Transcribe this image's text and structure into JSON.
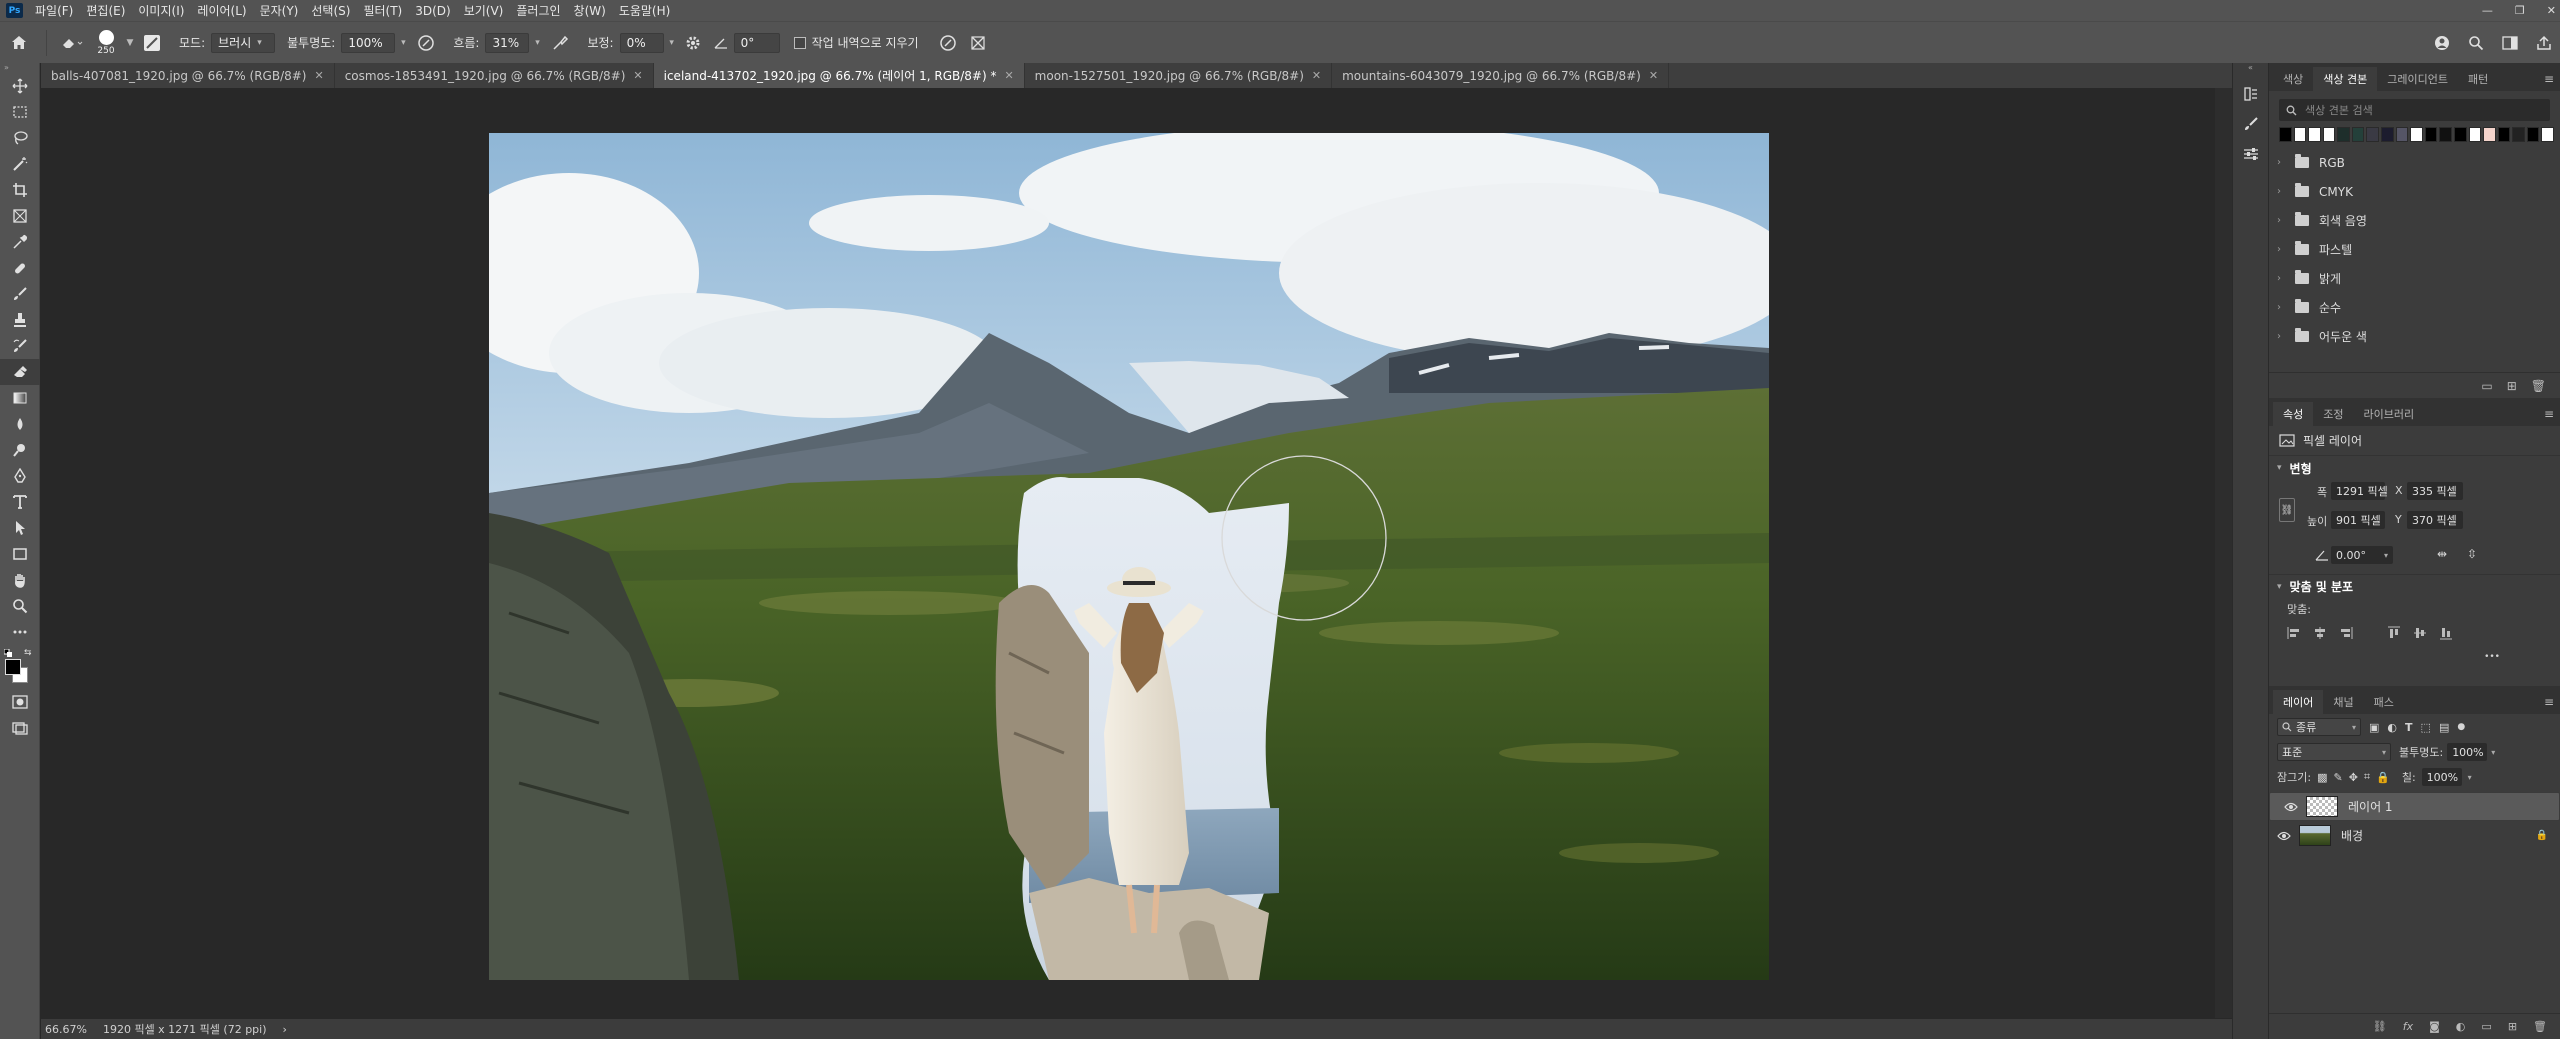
{
  "app": {
    "logo": "Ps"
  },
  "menu": [
    "파일(F)",
    "편집(E)",
    "이미지(I)",
    "레이어(L)",
    "문자(Y)",
    "선택(S)",
    "필터(T)",
    "3D(D)",
    "보기(V)",
    "플러그인",
    "창(W)",
    "도움말(H)"
  ],
  "window_controls": {
    "minimize": "—",
    "restore": "❐",
    "close": "✕"
  },
  "options": {
    "brush_size": "250",
    "mode_label": "모드:",
    "mode_value": "브러시",
    "opacity_label": "불투명도:",
    "opacity_value": "100%",
    "flow_label": "흐름:",
    "flow_value": "31%",
    "smoothing_label": "보정:",
    "smoothing_value": "0%",
    "angle_value": "0°",
    "erase_history_label": "작업 내역으로 지우기"
  },
  "tabs": [
    {
      "label": "balls-407081_1920.jpg @ 66.7% (RGB/8#)"
    },
    {
      "label": "cosmos-1853491_1920.jpg @ 66.7% (RGB/8#)"
    },
    {
      "label": "iceland-413702_1920.jpg @ 66.7% (레이어 1, RGB/8#) *"
    },
    {
      "label": "moon-1527501_1920.jpg @ 66.7% (RGB/8#)"
    },
    {
      "label": "mountains-6043079_1920.jpg @ 66.7% (RGB/8#)"
    }
  ],
  "status": {
    "zoom": "66.67%",
    "doc_info": "1920 픽셀 x 1271 픽셀 (72 ppi)",
    "arrow": "›"
  },
  "swatches_panel": {
    "tabs": [
      "색상",
      "색상 견본",
      "그레이디언트",
      "패턴"
    ],
    "active_tab": "색상 견본",
    "search_placeholder": "색상 견본 검색",
    "swatch_colors": [
      "#000000",
      "#ffffff",
      "#ffffff",
      "#ffffff",
      "#1e2e2b",
      "#24403a",
      "#3a3a44",
      "#1c1c2e",
      "#555566",
      "#ffffff",
      "#000000",
      "#111111",
      "#000000",
      "#ffffff",
      "#f4d4cc",
      "#000000",
      "#222222",
      "#000000",
      "#ffffff"
    ],
    "folders": [
      "RGB",
      "CMYK",
      "회색 음영",
      "파스텔",
      "밝게",
      "순수",
      "어두운 색"
    ]
  },
  "properties_panel": {
    "tabs": [
      "속성",
      "조정",
      "라이브러리"
    ],
    "layer_kind": "픽셀 레이어",
    "transform_title": "변형",
    "w_label": "폭",
    "w_value": "1291 픽셀",
    "x_label": "X",
    "x_value": "335 픽셀",
    "h_label": "높이",
    "h_value": "901 픽셀",
    "y_label": "Y",
    "y_value": "370 픽셀",
    "angle_value": "0.00°",
    "align_title": "맞춤 및 분포",
    "align_label": "맞춤:",
    "more": "•••"
  },
  "layers_panel": {
    "tabs": [
      "레이어",
      "채널",
      "패스"
    ],
    "filter_label": "종류",
    "blend_mode": "표준",
    "opacity_label": "불투명도:",
    "opacity_value": "100%",
    "lock_label": "잠그기:",
    "fill_label": "칠:",
    "fill_value": "100%",
    "layers": [
      {
        "name": "레이어 1",
        "selected": true
      },
      {
        "name": "배경",
        "selected": false,
        "locked": true
      }
    ]
  }
}
